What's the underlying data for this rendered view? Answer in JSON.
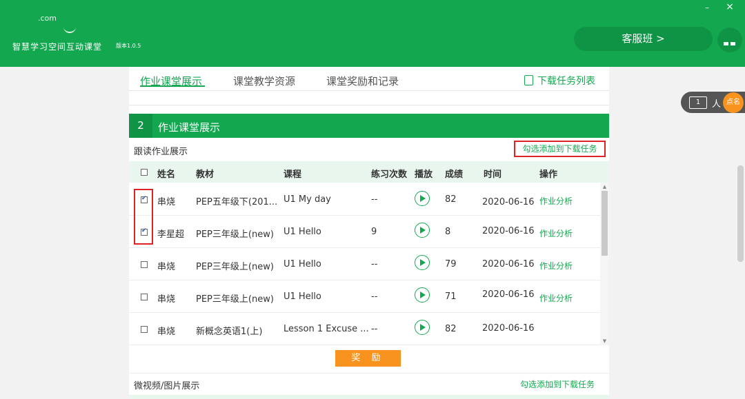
{
  "app": {
    "logo_text": ".com",
    "title": "智慧学习空间互动课堂",
    "version": "版本1.0.5"
  },
  "window": {
    "minimize_glyph": "–",
    "close_glyph": "×"
  },
  "header": {
    "service_button": "客服班 >"
  },
  "tabs": [
    {
      "label": "作业课堂展示",
      "active": true
    },
    {
      "label": "课堂教学资源",
      "active": false
    },
    {
      "label": "课堂奖励和记录",
      "active": false
    }
  ],
  "download_list_label": "下载任务列表",
  "section": {
    "number": "2",
    "title": "作业课堂展示",
    "subtitle": "跟读作业展示",
    "add_to_download": "勾选添加到下载任务"
  },
  "table": {
    "columns": [
      "姓名",
      "教材",
      "课程",
      "练习次数",
      "播放",
      "成绩",
      "时间",
      "操作"
    ],
    "rows": [
      {
        "checked": true,
        "name": "串烧",
        "textbook": "PEP五年级下(201...",
        "lesson": "U1 My day",
        "count": "--",
        "score": "82",
        "time": "2020-06-16",
        "action": "作业分析"
      },
      {
        "checked": true,
        "name": "李星超",
        "textbook": "PEP三年级上(new)",
        "lesson": "U1 Hello",
        "count": "9",
        "score": "8",
        "time": "2020-06-16",
        "action": "作业分析"
      },
      {
        "checked": false,
        "name": "串烧",
        "textbook": "PEP三年级上(new)",
        "lesson": "U1 Hello",
        "count": "--",
        "score": "79",
        "time": "2020-06-16",
        "action": "作业分析"
      },
      {
        "checked": false,
        "name": "串烧",
        "textbook": "PEP三年级上(new)",
        "lesson": "U1 Hello",
        "count": "--",
        "score": "71",
        "time": "2020-06-16",
        "action": "作业分析"
      },
      {
        "checked": false,
        "name": "串烧",
        "textbook": "新概念英语1(上)",
        "lesson": "Lesson 1 Excuse ...",
        "count": "--",
        "score": "82",
        "time": "2020-06-16",
        "action": ""
      }
    ]
  },
  "reward_button": "奖 励",
  "video_section": {
    "title": "微视频/图片展示",
    "add_to_download": "勾选添加到下载任务"
  },
  "roll_call": {
    "count": "1",
    "unit": "人",
    "button": "点名"
  },
  "colors": {
    "brand_green": "#13a84f",
    "accent_orange": "#f7931e",
    "highlight_red": "#dd2222"
  },
  "icons": [
    "minimize-icon",
    "close-icon",
    "download-list-icon",
    "play-icon",
    "checkbox-icon"
  ]
}
